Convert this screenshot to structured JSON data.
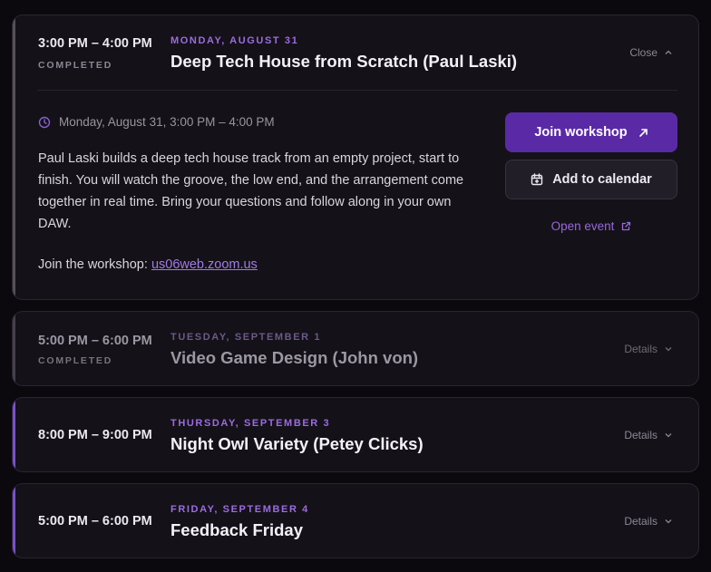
{
  "sessions": [
    {
      "time": "3:00 PM – 4:00 PM",
      "status": "COMPLETED",
      "date": "MONDAY, AUGUST 31",
      "title": "Deep Tech House from Scratch (Paul Laski)",
      "toggle_label": "Close",
      "when": "Monday, August 31, 3:00 PM – 4:00 PM",
      "description": "Paul Laski builds a deep tech house track from an empty project, start to finish. You will watch the groove, the low end, and the arrangement come together in real time. Bring your questions and follow along in your own DAW.",
      "join_prefix": "Join the workshop: ",
      "join_link": "us06web.zoom.us",
      "join_button": "Join workshop",
      "calendar_button": "Add to calendar",
      "open_event": "Open event"
    },
    {
      "time": "5:00 PM – 6:00 PM",
      "status": "COMPLETED",
      "date": "TUESDAY, SEPTEMBER 1",
      "title": "Video Game Design (John von)",
      "toggle_label": "Details"
    },
    {
      "time": "8:00 PM – 9:00 PM",
      "date": "THURSDAY, SEPTEMBER 3",
      "title": "Night Owl Variety (Petey Clicks)",
      "toggle_label": "Details"
    },
    {
      "time": "5:00 PM – 6:00 PM",
      "date": "FRIDAY, SEPTEMBER 4",
      "title": "Feedback Friday",
      "toggle_label": "Details"
    }
  ],
  "colors": {
    "accent": "#5a2aa6",
    "date_purple": "#9b6ce0",
    "background": "#0b090e",
    "card": "#141118"
  }
}
